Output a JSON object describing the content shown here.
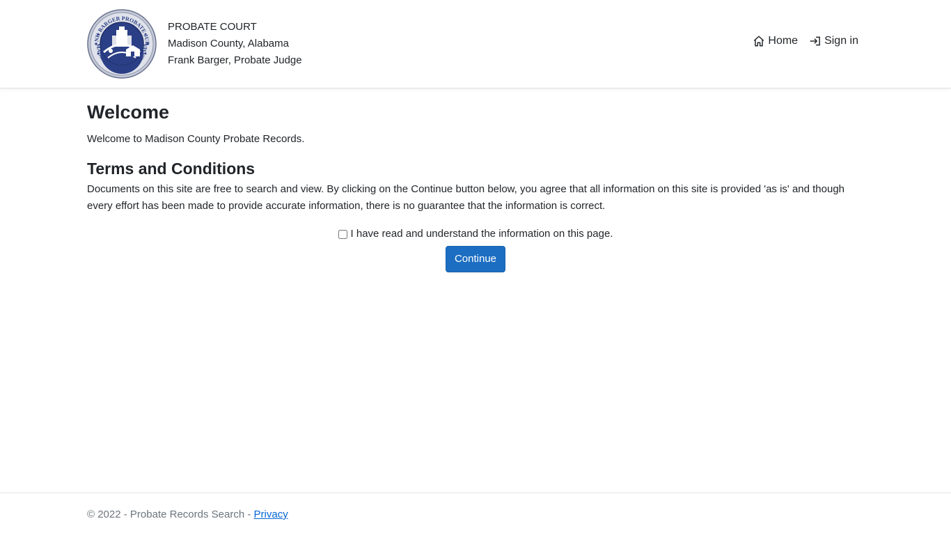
{
  "header": {
    "seal": {
      "icon": "probate-judge-seal",
      "top_text": "FRANK BARGER PROBATE JUDGE",
      "bottom_text": "MADISON COUNTY ALABAMA"
    },
    "brand_line1": "PROBATE COURT",
    "brand_line2": "Madison County, Alabama",
    "brand_line3": "Frank Barger, Probate Judge",
    "nav": {
      "home_label": "Home",
      "home_icon": "house-icon",
      "signin_label": "Sign in",
      "signin_icon": "box-arrow-in-right-icon"
    }
  },
  "main": {
    "title": "Welcome",
    "welcome_text": "Welcome to Madison County Probate Records.",
    "terms_title": "Terms and Conditions",
    "terms_text": "Documents on this site are free to search and view. By clicking on the Continue button below, you agree that all information on this site is provided 'as is' and though every effort has been made to provide accurate information, there is no guarantee that the information is correct.",
    "agree_label": "I have read and understand the information on this page.",
    "agree_checked": false,
    "continue_label": "Continue"
  },
  "footer": {
    "copyright": "© 2022 - Probate Records Search - ",
    "privacy_label": "Privacy"
  },
  "colors": {
    "button": "#1b6ec2",
    "seal_blue": "#2b3f86",
    "seal_ring": "#b9bfcc"
  }
}
